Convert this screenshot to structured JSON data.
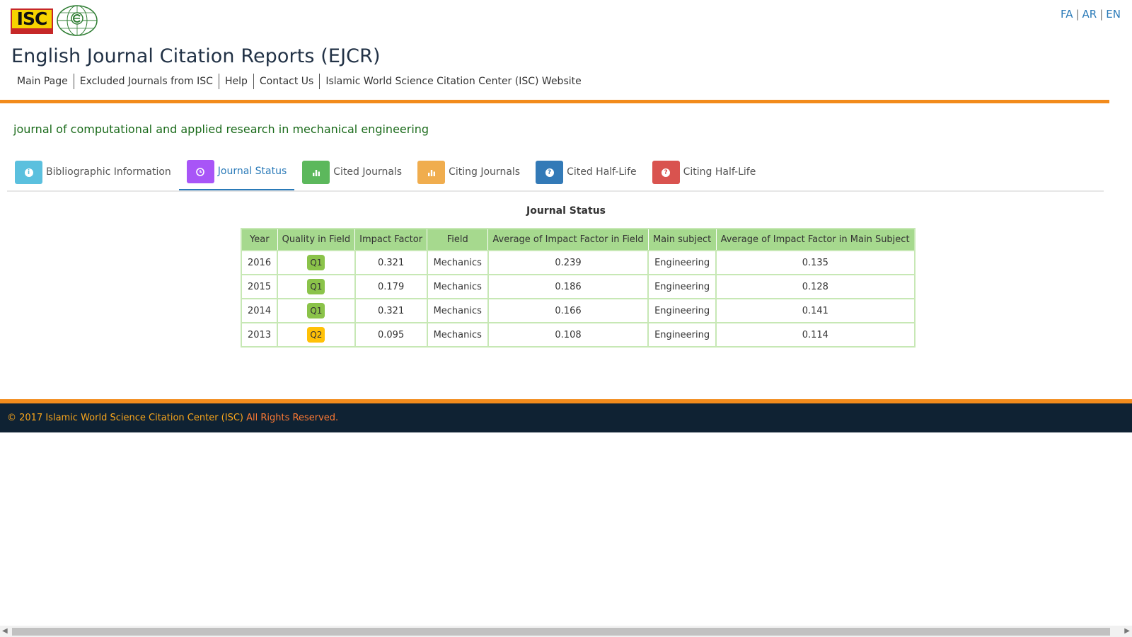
{
  "header": {
    "logo_text": "ISC",
    "languages": [
      "FA",
      "AR",
      "EN"
    ],
    "site_title": "English Journal Citation Reports (EJCR)",
    "nav": [
      "Main Page",
      "Excluded Journals from ISC",
      "Help",
      "Contact Us",
      "Islamic World Science Citation Center (ISC) Website"
    ]
  },
  "journal": {
    "name": "journal of computational and applied research in mechanical engineering"
  },
  "tabs": [
    {
      "label": "Bibliographic Information",
      "icon": "info-icon",
      "color": "#5bc0de",
      "active": false
    },
    {
      "label": "Journal Status",
      "icon": "clock-icon",
      "color": "#a855f7",
      "active": true
    },
    {
      "label": "Cited Journals",
      "icon": "bar-chart-icon",
      "color": "#5cb85c",
      "active": false
    },
    {
      "label": "Citing Journals",
      "icon": "bar-chart-icon",
      "color": "#f0ad4e",
      "active": false
    },
    {
      "label": "Cited Half-Life",
      "icon": "question-icon",
      "color": "#337ab7",
      "active": false
    },
    {
      "label": "Citing Half-Life",
      "icon": "question-icon",
      "color": "#d9534f",
      "active": false
    }
  ],
  "status_table": {
    "caption": "Journal Status",
    "headers": [
      "Year",
      "Quality in Field",
      "Impact Factor",
      "Field",
      "Average of Impact Factor in Field",
      "Main subject",
      "Average of Impact Factor in Main Subject"
    ],
    "rows": [
      {
        "year": "2016",
        "quality": "Q1",
        "impact_factor": "0.321",
        "field": "Mechanics",
        "avg_if_field": "0.239",
        "main_subject": "Engineering",
        "avg_if_main": "0.135"
      },
      {
        "year": "2015",
        "quality": "Q1",
        "impact_factor": "0.179",
        "field": "Mechanics",
        "avg_if_field": "0.186",
        "main_subject": "Engineering",
        "avg_if_main": "0.128"
      },
      {
        "year": "2014",
        "quality": "Q1",
        "impact_factor": "0.321",
        "field": "Mechanics",
        "avg_if_field": "0.166",
        "main_subject": "Engineering",
        "avg_if_main": "0.141"
      },
      {
        "year": "2013",
        "quality": "Q2",
        "impact_factor": "0.095",
        "field": "Mechanics",
        "avg_if_field": "0.108",
        "main_subject": "Engineering",
        "avg_if_main": "0.114"
      }
    ],
    "quality_colors": {
      "Q1": "#8bc34a",
      "Q2": "#ffc107"
    }
  },
  "footer": {
    "copyright": "© 2017 Islamic World Science Citation Center (ISC)",
    "rights": " All Rights Reserved."
  },
  "colors": {
    "accent_orange": "#f28b1c",
    "footer_bg": "#0f2233",
    "link_blue": "#2a7ab8",
    "journal_green": "#1b6b1b",
    "table_header_green": "#a6d98e"
  }
}
